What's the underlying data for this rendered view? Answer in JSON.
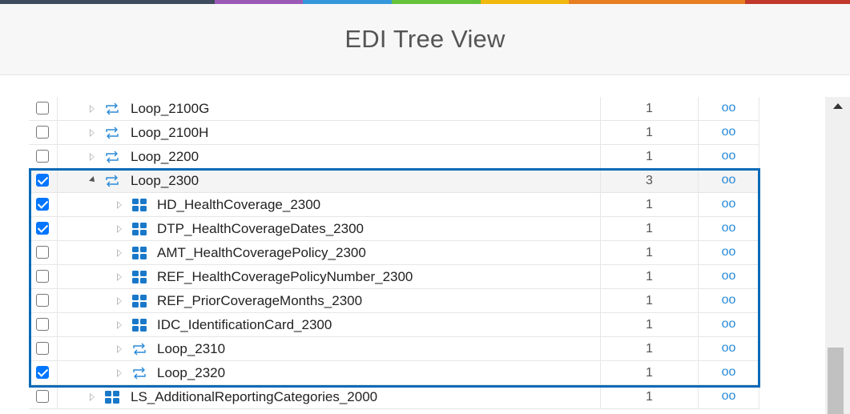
{
  "top_bar_colors": [
    "#3d4b5c",
    "#9b59b6",
    "#3498db",
    "#65c23b",
    "#f1b80f",
    "#e67e22",
    "#c0392b"
  ],
  "page_title": "EDI Tree View",
  "link_glyph": "oo",
  "rows": [
    {
      "label": "Loop_2100G",
      "count": "1",
      "checked": false,
      "icon": "loop-icon",
      "level": 0,
      "expanded": false
    },
    {
      "label": "Loop_2100H",
      "count": "1",
      "checked": false,
      "icon": "loop-icon",
      "level": 0,
      "expanded": false
    },
    {
      "label": "Loop_2200",
      "count": "1",
      "checked": false,
      "icon": "loop-icon",
      "level": 0,
      "expanded": false
    },
    {
      "label": "Loop_2300",
      "count": "3",
      "checked": true,
      "icon": "loop-icon",
      "level": 0,
      "expanded": true
    },
    {
      "label": "HD_HealthCoverage_2300",
      "count": "1",
      "checked": true,
      "icon": "segment-icon",
      "level": 1,
      "expanded": false
    },
    {
      "label": "DTP_HealthCoverageDates_2300",
      "count": "1",
      "checked": true,
      "icon": "segment-icon",
      "level": 1,
      "expanded": false
    },
    {
      "label": "AMT_HealthCoveragePolicy_2300",
      "count": "1",
      "checked": false,
      "icon": "segment-icon",
      "level": 1,
      "expanded": false
    },
    {
      "label": "REF_HealthCoveragePolicyNumber_2300",
      "count": "1",
      "checked": false,
      "icon": "segment-icon",
      "level": 1,
      "expanded": false
    },
    {
      "label": "REF_PriorCoverageMonths_2300",
      "count": "1",
      "checked": false,
      "icon": "segment-icon",
      "level": 1,
      "expanded": false
    },
    {
      "label": "IDC_IdentificationCard_2300",
      "count": "1",
      "checked": false,
      "icon": "segment-icon",
      "level": 1,
      "expanded": false
    },
    {
      "label": "Loop_2310",
      "count": "1",
      "checked": false,
      "icon": "loop-icon",
      "level": 1,
      "expanded": false
    },
    {
      "label": "Loop_2320",
      "count": "1",
      "checked": true,
      "icon": "loop-icon",
      "level": 1,
      "expanded": false
    },
    {
      "label": "LS_AdditionalReportingCategories_2000",
      "count": "1",
      "checked": false,
      "icon": "segment-icon",
      "level": 0,
      "expanded": false
    }
  ]
}
